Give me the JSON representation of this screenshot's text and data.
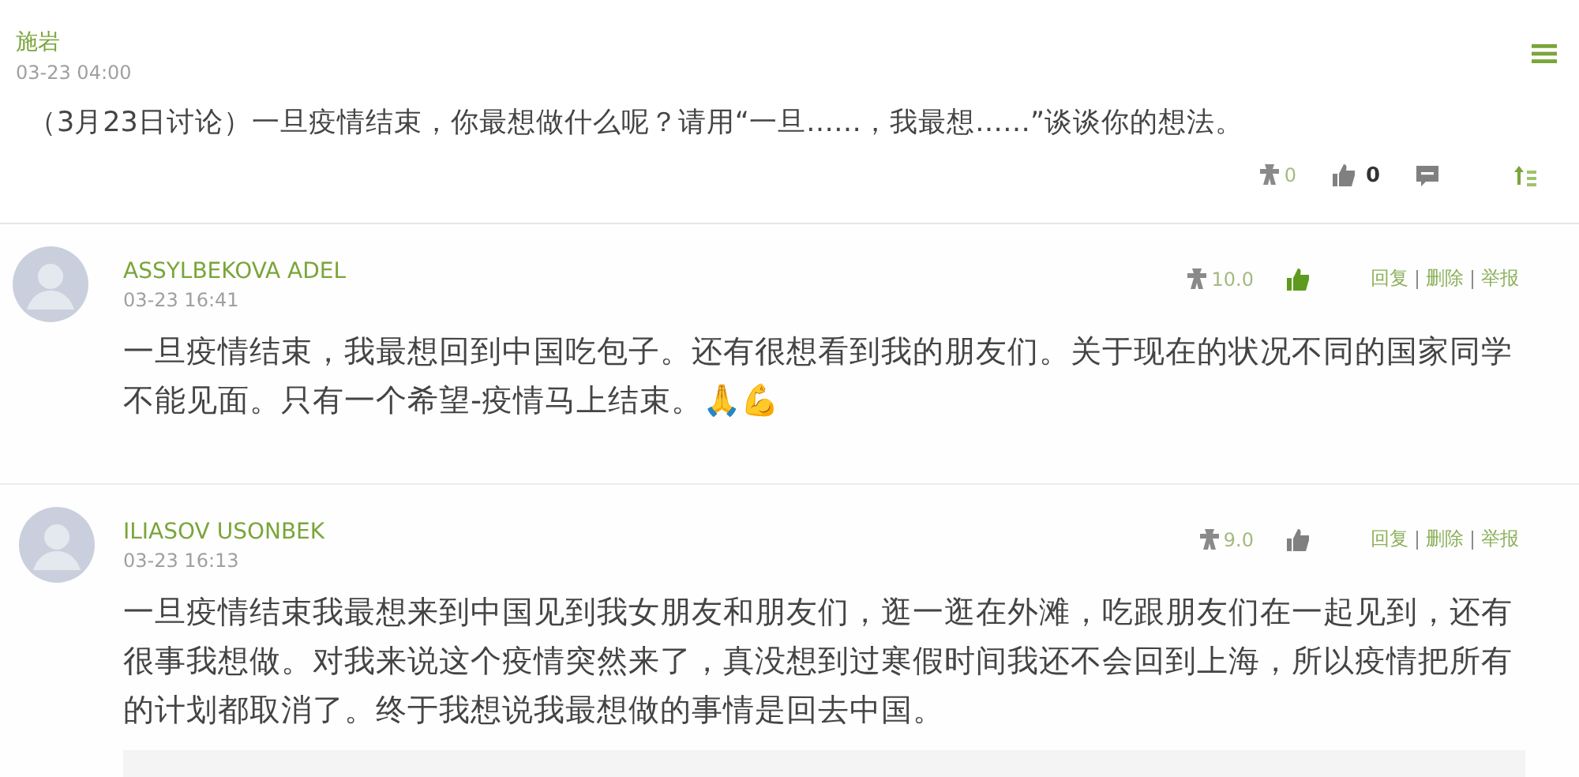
{
  "topic": {
    "author": "施岩",
    "time": "03-23 04:00",
    "text": "（3月23日讨论）一旦疫情结束，你最想做什么呢？请用“一旦……，我最想……”谈谈你的想法。",
    "score": "0",
    "likes": "0",
    "liked": false
  },
  "comments": [
    {
      "author": "ASSYLBEKOVA ADEL",
      "time": "03-23 16:41",
      "text": "一旦疫情结束，我最想回到中国吃包子。还有很想看到我的朋友们。关于现在的状况不同的国家同学不能见面。只有一个希望-疫情马上结束。🙏💪",
      "score": "10.0",
      "liked": true,
      "actions": [
        "回复",
        "删除",
        "举报"
      ]
    },
    {
      "author": "ILIASOV USONBEK",
      "time": "03-23 16:13",
      "text": "一旦疫情结束我最想来到中国见到我女朋友和朋友们，逛一逛在外滩，吃跟朋友们在一起见到，还有很事我想做。对我来说这个疫情突然来了，真没想到过寒假时间我还不会回到上海，所以疫情把所有的计划都取消了。终于我想说我最想做的事情是回去中国。",
      "score": "9.0",
      "liked": false,
      "actions": [
        "回复",
        "删除",
        "举报"
      ]
    }
  ]
}
